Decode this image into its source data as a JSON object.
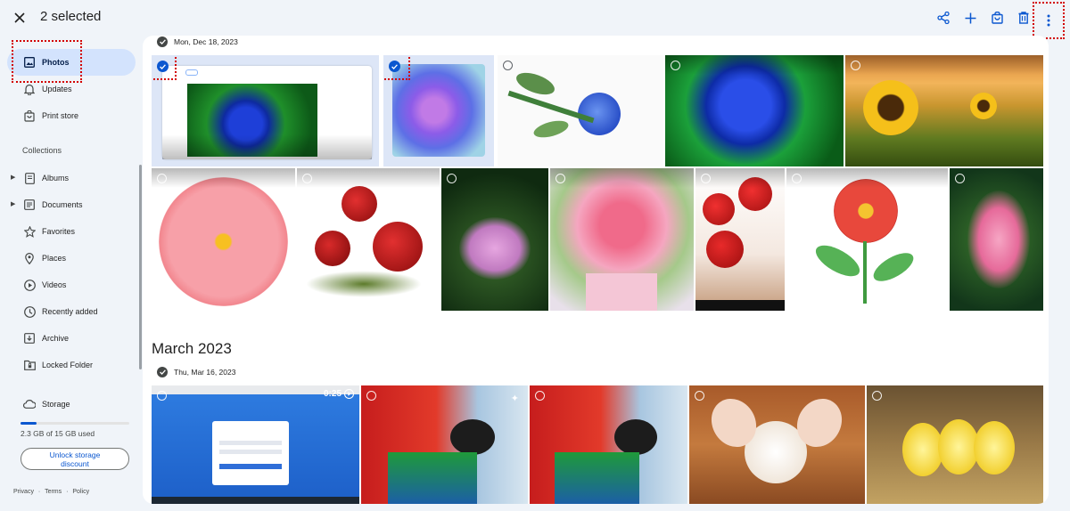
{
  "topbar": {
    "selected_label": "2 selected"
  },
  "sidebar": {
    "items": [
      {
        "label": "Photos"
      },
      {
        "label": "Updates"
      },
      {
        "label": "Print store"
      }
    ],
    "collections_header": "Collections",
    "collections": [
      {
        "label": "Albums"
      },
      {
        "label": "Documents"
      },
      {
        "label": "Favorites"
      },
      {
        "label": "Places"
      },
      {
        "label": "Videos"
      },
      {
        "label": "Recently added"
      },
      {
        "label": "Archive"
      },
      {
        "label": "Locked Folder"
      }
    ],
    "storage": {
      "label": "Storage",
      "usage_text": "2.3 GB of 15 GB used",
      "fraction_used": 0.15
    },
    "unlock": {
      "line1": "Unlock storage",
      "line2": "discount"
    },
    "footer": {
      "privacy": "Privacy",
      "terms": "Terms",
      "policy": "Policy",
      "sep": "·"
    }
  },
  "main": {
    "group1_date": "Mon, Dec 18, 2023",
    "month_title": "March 2023",
    "group2_date": "Thu, Mar 16, 2023",
    "video_duration": "0:25"
  },
  "colors": {
    "accent": "#0b57d0",
    "selection": "#d3e3fd",
    "annotation": "#d30000"
  }
}
